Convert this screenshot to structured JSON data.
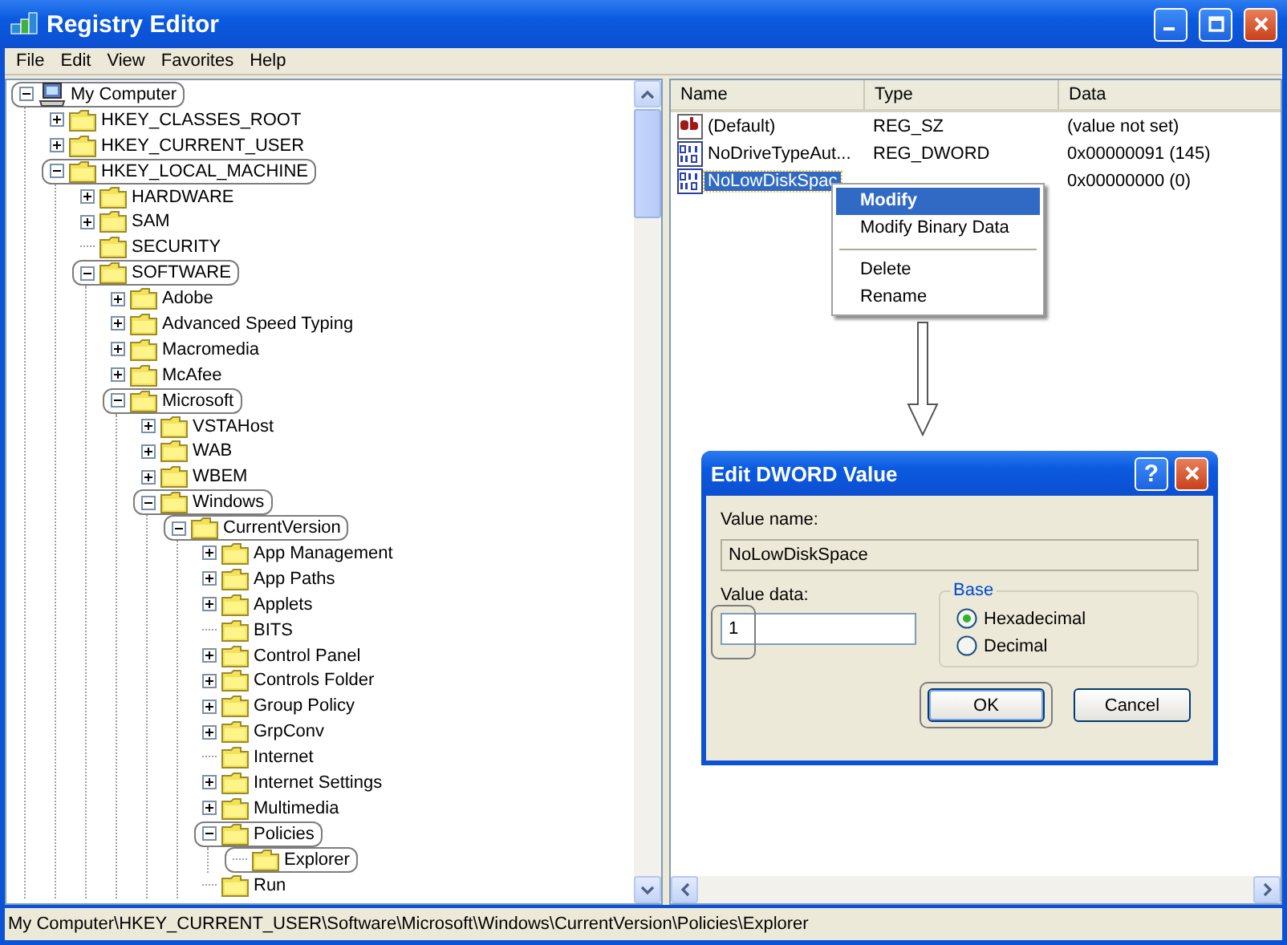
{
  "window": {
    "title": "Registry Editor"
  },
  "menu": [
    "File",
    "Edit",
    "View",
    "Favorites",
    "Help"
  ],
  "tree": [
    {
      "label": "My Computer",
      "kind": "computer",
      "expanded": true,
      "circled": true,
      "children": [
        {
          "label": "HKEY_CLASSES_ROOT",
          "kind": "folder",
          "expanded": false,
          "circled": false
        },
        {
          "label": "HKEY_CURRENT_USER",
          "kind": "folder",
          "expanded": false,
          "circled": false
        },
        {
          "label": "HKEY_LOCAL_MACHINE",
          "kind": "folder",
          "expanded": true,
          "circled": true,
          "children": [
            {
              "label": "HARDWARE",
              "kind": "folder",
              "expanded": false,
              "circled": false
            },
            {
              "label": "SAM",
              "kind": "folder",
              "expanded": false,
              "circled": false
            },
            {
              "label": "SECURITY",
              "kind": "folder",
              "circled": false
            },
            {
              "label": "SOFTWARE",
              "kind": "folder",
              "expanded": true,
              "circled": true,
              "children": [
                {
                  "label": "Adobe",
                  "kind": "folder",
                  "expanded": false,
                  "circled": false
                },
                {
                  "label": "Advanced Speed Typing",
                  "kind": "folder",
                  "expanded": false,
                  "circled": false
                },
                {
                  "label": "Macromedia",
                  "kind": "folder",
                  "expanded": false,
                  "circled": false
                },
                {
                  "label": "McAfee",
                  "kind": "folder",
                  "expanded": false,
                  "circled": false
                },
                {
                  "label": "Microsoft",
                  "kind": "folder",
                  "expanded": true,
                  "circled": true,
                  "children": [
                    {
                      "label": "VSTAHost",
                      "kind": "folder",
                      "expanded": false,
                      "circled": false
                    },
                    {
                      "label": "WAB",
                      "kind": "folder",
                      "expanded": false,
                      "circled": false
                    },
                    {
                      "label": "WBEM",
                      "kind": "folder",
                      "expanded": false,
                      "circled": false
                    },
                    {
                      "label": "Windows",
                      "kind": "folder",
                      "expanded": true,
                      "circled": true,
                      "children": [
                        {
                          "label": "CurrentVersion",
                          "kind": "folder",
                          "expanded": true,
                          "circled": true,
                          "children": [
                            {
                              "label": "App Management",
                              "kind": "folder",
                              "expanded": false,
                              "circled": false
                            },
                            {
                              "label": "App Paths",
                              "kind": "folder",
                              "expanded": false,
                              "circled": false
                            },
                            {
                              "label": "Applets",
                              "kind": "folder",
                              "expanded": false,
                              "circled": false
                            },
                            {
                              "label": "BITS",
                              "kind": "folder",
                              "circled": false
                            },
                            {
                              "label": "Control Panel",
                              "kind": "folder",
                              "expanded": false,
                              "circled": false
                            },
                            {
                              "label": "Controls Folder",
                              "kind": "folder",
                              "expanded": false,
                              "circled": false
                            },
                            {
                              "label": "Group Policy",
                              "kind": "folder",
                              "expanded": false,
                              "circled": false
                            },
                            {
                              "label": "GrpConv",
                              "kind": "folder",
                              "expanded": false,
                              "circled": false
                            },
                            {
                              "label": "Internet",
                              "kind": "folder",
                              "circled": false
                            },
                            {
                              "label": "Internet Settings",
                              "kind": "folder",
                              "expanded": false,
                              "circled": false
                            },
                            {
                              "label": "Multimedia",
                              "kind": "folder",
                              "expanded": false,
                              "circled": false
                            },
                            {
                              "label": "Policies",
                              "kind": "folder",
                              "expanded": true,
                              "circled": true,
                              "children": [
                                {
                                  "label": "Explorer",
                                  "kind": "folder",
                                  "circled": true
                                }
                              ]
                            },
                            {
                              "label": "Run",
                              "kind": "folder",
                              "circled": false
                            }
                          ]
                        }
                      ]
                    }
                  ]
                }
              ]
            }
          ]
        }
      ]
    }
  ],
  "values": {
    "columns": [
      "Name",
      "Type",
      "Data"
    ],
    "rows": [
      {
        "kind": "string",
        "name": "(Default)",
        "type": "REG_SZ",
        "data": "(value not set)",
        "selected": false
      },
      {
        "kind": "dword",
        "name": "NoDriveTypeAut...",
        "type": "REG_DWORD",
        "data": "0x00000091 (145)",
        "selected": false
      },
      {
        "kind": "dword",
        "name": "NoLowDiskSpac",
        "data": "0x00000000 (0)",
        "selected": true
      }
    ]
  },
  "context_menu": [
    {
      "kind": "item",
      "label": "Modify",
      "selected": true,
      "default": true
    },
    {
      "kind": "item",
      "label": "Modify Binary Data",
      "selected": false,
      "default": false
    },
    {
      "kind": "separator"
    },
    {
      "kind": "item",
      "label": "Delete",
      "selected": false,
      "default": false
    },
    {
      "kind": "item",
      "label": "Rename",
      "selected": false,
      "default": false
    }
  ],
  "dialog": {
    "title": "Edit DWORD Value",
    "help_button": "?",
    "value_name_label": "Value name:",
    "value_name": "NoLowDiskSpace",
    "value_data_label": "Value data:",
    "value_data": "1",
    "value_data_circled": true,
    "base_label": "Base",
    "radios": [
      {
        "label": "Hexadecimal",
        "selected": true
      },
      {
        "label": "Decimal",
        "selected": false
      }
    ],
    "buttons": [
      {
        "label": "OK",
        "default": true,
        "circled": true
      },
      {
        "label": "Cancel",
        "default": false,
        "circled": false
      }
    ]
  },
  "status_bar": "My Computer\\HKEY_CURRENT_USER\\Software\\Microsoft\\Windows\\CurrentVersion\\Policies\\Explorer"
}
